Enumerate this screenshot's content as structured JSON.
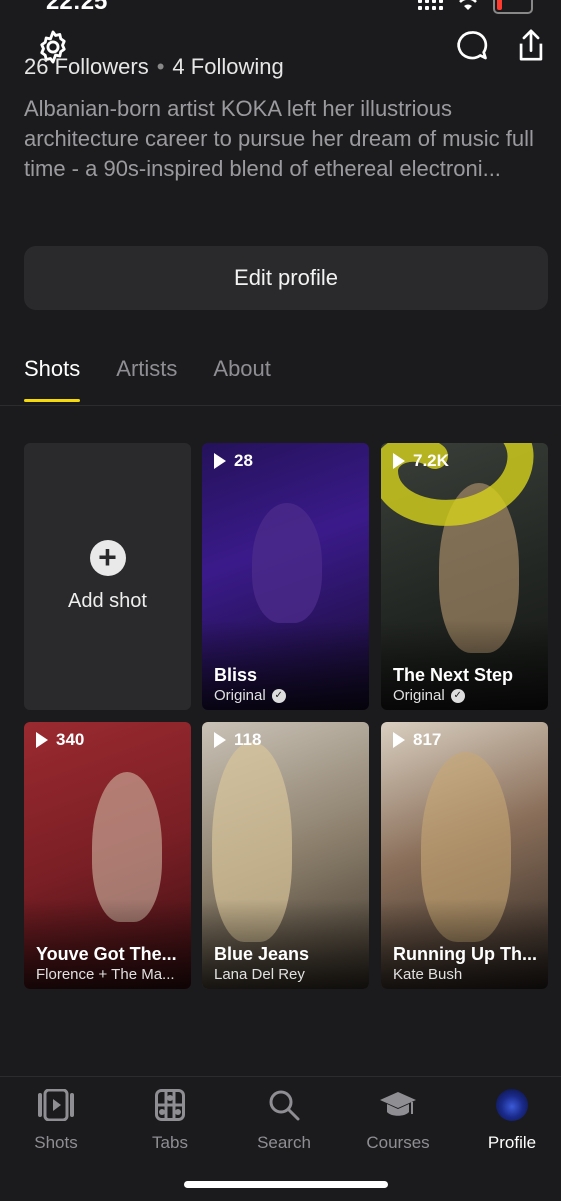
{
  "status_bar": {
    "time": "22:25"
  },
  "profile": {
    "followers": "26 Followers",
    "following": "4 Following",
    "bio": "Albanian-born artist KOKA left her illustrious architecture career to pursue her dream of music full time - a 90s-inspired blend of ethereal electroni...",
    "edit_label": "Edit profile"
  },
  "tabs": [
    "Shots",
    "Artists",
    "About"
  ],
  "add_shot_label": "Add shot",
  "shots": [
    {
      "plays": "28",
      "title": "Bliss",
      "subtitle": "Original",
      "verified": true
    },
    {
      "plays": "7.2K",
      "title": "The Next Step",
      "subtitle": "Original",
      "verified": true
    },
    {
      "plays": "340",
      "title": "Youve Got The...",
      "subtitle": "Florence + The Ma..."
    },
    {
      "plays": "118",
      "title": "Blue Jeans",
      "subtitle": "Lana Del Rey"
    },
    {
      "plays": "817",
      "title": "Running Up Th...",
      "subtitle": "Kate Bush"
    }
  ],
  "nav": [
    "Shots",
    "Tabs",
    "Search",
    "Courses",
    "Profile"
  ],
  "colors": {
    "accent": "#f5d90a",
    "background": "#1b1b1d",
    "battery_low": "#ff3b30"
  }
}
